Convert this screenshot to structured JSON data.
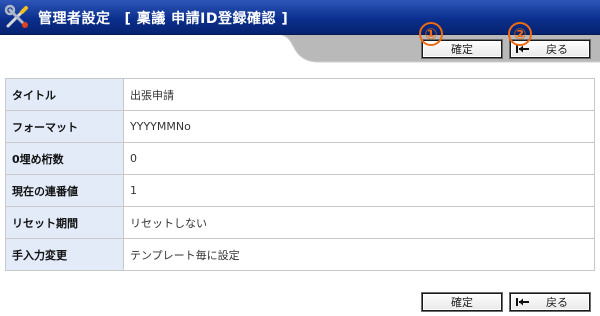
{
  "header": {
    "title": "管理者設定",
    "subtitle": "[ 稟議 申請ID登録確認 ]"
  },
  "markers": {
    "confirm": "①",
    "back": "②"
  },
  "actions": {
    "confirm_label": "確定",
    "back_label": "戻る"
  },
  "form": {
    "rows": [
      {
        "label": "タイトル",
        "value": "出張申請"
      },
      {
        "label": "フォーマット",
        "value": "YYYYMMNo"
      },
      {
        "label": "0埋め桁数",
        "value": "0"
      },
      {
        "label": "現在の連番値",
        "value": "1"
      },
      {
        "label": "リセット期間",
        "value": "リセットしない"
      },
      {
        "label": "手入力変更",
        "value": "テンプレート毎に設定"
      }
    ]
  },
  "colors": {
    "header": "#0b2f8e",
    "label_bg": "#e3ebf9",
    "marker": "#ee6a10"
  }
}
